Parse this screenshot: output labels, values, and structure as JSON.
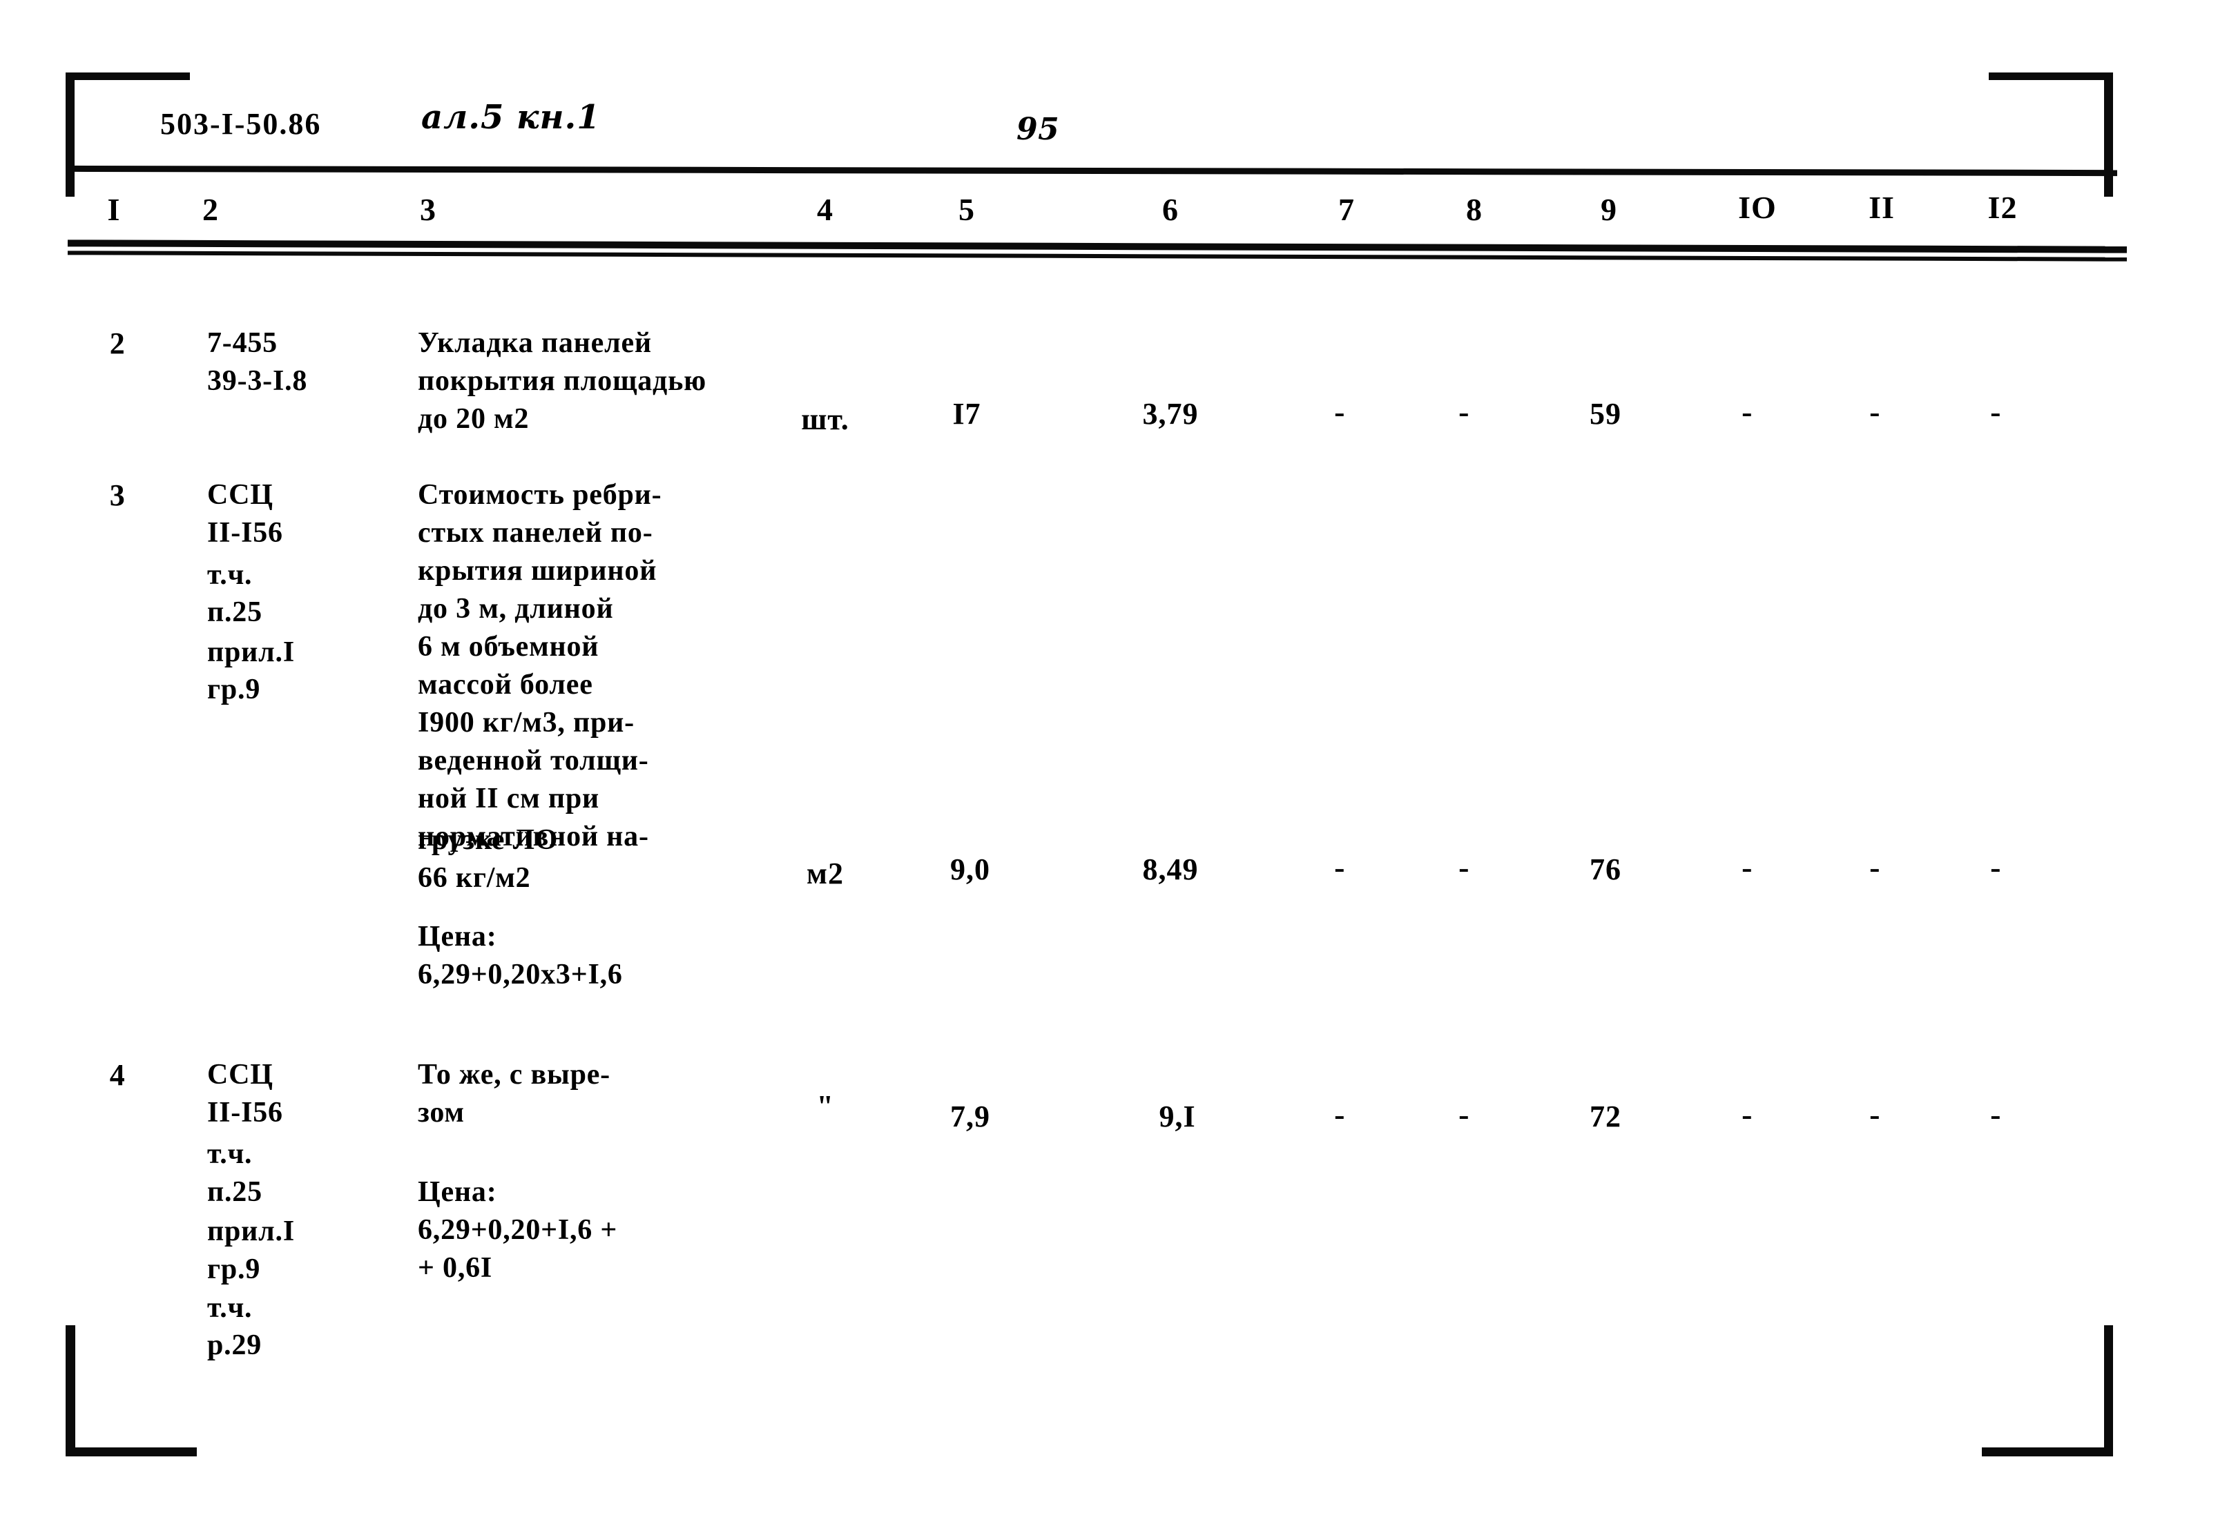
{
  "document": {
    "code": "503-I-50.86",
    "handwritten_album": "ал.5 кн.1",
    "page_number": "95"
  },
  "table": {
    "column_headers": [
      "I",
      "2",
      "3",
      "4",
      "5",
      "6",
      "7",
      "8",
      "9",
      "IO",
      "II",
      "I2"
    ],
    "rows": [
      {
        "num": "2",
        "code_lines": [
          "7-455",
          "39-3-I.8"
        ],
        "description_lines": [
          "Укладка панелей",
          "покрытия площадью",
          "до 20 м2"
        ],
        "unit": "шт.",
        "c5": "I7",
        "c6": "3,79",
        "c7": "-",
        "c8": "-",
        "c9": "59",
        "c10": "-",
        "c11": "-",
        "c12": "-"
      },
      {
        "num": "3",
        "code_lines": [
          "ССЦ",
          "II-I56",
          "т.ч.",
          "п.25",
          "прил.I",
          "гр.9"
        ],
        "description_lines": [
          "Стоимость ребри-",
          "стых панелей по-",
          "крытия шириной",
          "до 3 м, длиной",
          "6 м объемной",
          "массой более",
          "I900 кг/м3, при-",
          "веденной толщи-",
          "ной II см при",
          "нормативной на-",
          "грузке ЛО",
          "66 кг/м2"
        ],
        "price_label": "Цена:",
        "price_lines": [
          "6,29+0,20х3+I,6"
        ],
        "unit": "м2",
        "c5": "9,0",
        "c6": "8,49",
        "c7": "-",
        "c8": "-",
        "c9": "76",
        "c10": "-",
        "c11": "-",
        "c12": "-"
      },
      {
        "num": "4",
        "code_lines": [
          "ССЦ",
          "II-I56",
          "т.ч.",
          "п.25",
          "прил.I",
          "гр.9",
          "т.ч.",
          "р.29"
        ],
        "description_lines": [
          "То же, с выре-",
          "зом"
        ],
        "price_label": "Цена:",
        "price_lines": [
          "6,29+0,20+I,6 +",
          "+ 0,6I"
        ],
        "unit": "\"",
        "c5": "7,9",
        "c6": "9,I",
        "c7": "-",
        "c8": "-",
        "c9": "72",
        "c10": "-",
        "c11": "-",
        "c12": "-"
      }
    ]
  },
  "colors": {
    "ink": "#0a0a0a",
    "paper": "#ffffff"
  }
}
